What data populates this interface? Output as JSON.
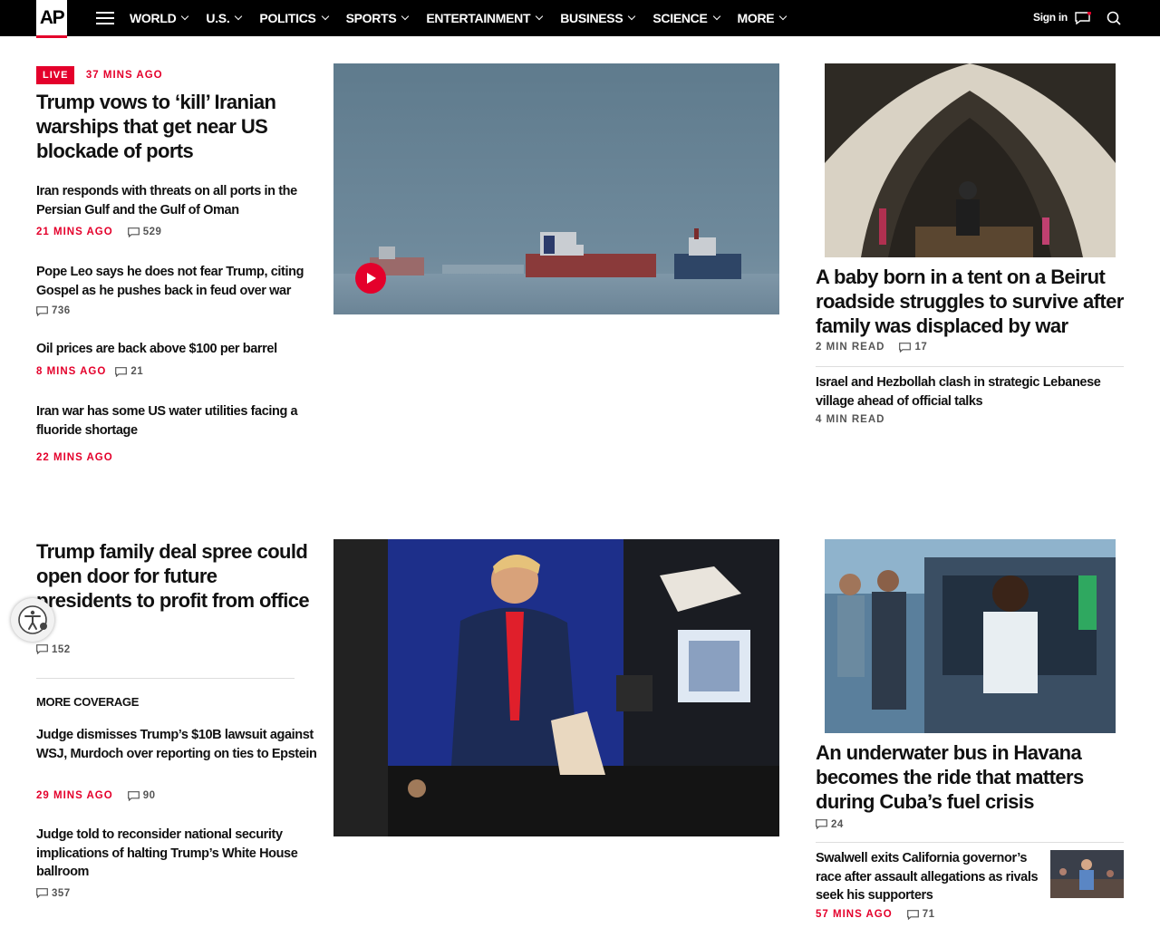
{
  "nav": {
    "logo": "AP",
    "items": [
      {
        "label": "WORLD"
      },
      {
        "label": "U.S."
      },
      {
        "label": "POLITICS"
      },
      {
        "label": "SPORTS"
      },
      {
        "label": "ENTERTAINMENT"
      },
      {
        "label": "BUSINESS"
      },
      {
        "label": "SCIENCE"
      },
      {
        "label": "MORE"
      }
    ],
    "signin": "Sign in"
  },
  "top": {
    "live_label": "LIVE",
    "live_time": "37 MINS AGO",
    "lead_headline": "Trump vows to ‘kill’ Iranian warships that get near US blockade of ports",
    "related": [
      {
        "headline": "Iran responds with threats on all ports in the Persian Gulf and the Gulf of Oman",
        "time": "21 MINS AGO",
        "comments": "529"
      },
      {
        "headline": "Pope Leo says he does not fear Trump, citing Gospel as he pushes back in feud over war",
        "time": "",
        "comments": "736"
      },
      {
        "headline": "Oil prices are back above $100 per barrel",
        "time": "8 MINS AGO",
        "comments": "21"
      },
      {
        "headline": "Iran war has some US water utilities facing a fluoride shortage",
        "time": "22 MINS AGO",
        "comments": ""
      }
    ],
    "side_headline": "A baby born in a tent on a Beirut roadside struggles to survive after family was displaced by war",
    "side_read": "2 MIN READ",
    "side_comments": "17",
    "side_sub_headline": "Israel and Hezbollah clash in strategic Lebanese village ahead of official talks",
    "side_sub_read": "4 MIN READ"
  },
  "second": {
    "lead_headline": "Trump family deal spree could open door for future presidents to profit from office",
    "lead_comments": "152",
    "more_coverage": "MORE COVERAGE",
    "related": [
      {
        "headline": "Judge dismisses Trump’s $10B lawsuit against WSJ, Murdoch over reporting on ties to Epstein",
        "time": "29 MINS AGO",
        "comments": "90"
      },
      {
        "headline": "Judge told to reconsider national security implications of halting Trump’s White House ballroom",
        "time": "",
        "comments": "357"
      }
    ],
    "side_headline": "An underwater bus in Havana becomes the ride that matters during Cuba’s fuel crisis",
    "side_comments": "24",
    "side_sub_headline": "Swalwell exits California governor’s race after assault allegations as rivals seek his supporters",
    "side_sub_time": "57 MINS AGO",
    "side_sub_comments": "71"
  },
  "colors": {
    "accent": "#e4002b",
    "nav_bg": "#000000"
  }
}
